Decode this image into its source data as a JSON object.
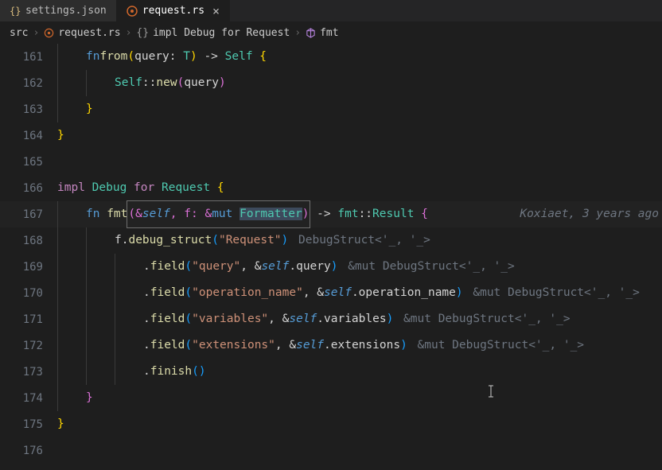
{
  "tabs": [
    {
      "label": "settings.json",
      "icon": "braces",
      "active": false
    },
    {
      "label": "request.rs",
      "icon": "rust",
      "active": true
    }
  ],
  "breadcrumbs": [
    {
      "label": "src",
      "icon": null
    },
    {
      "label": "request.rs",
      "icon": "rust"
    },
    {
      "label": "impl Debug for Request",
      "icon": "braces"
    },
    {
      "label": "fmt",
      "icon": "cube"
    }
  ],
  "code": {
    "161": {
      "kw_fn": "fn",
      "fn": "from",
      "p1": "(",
      "arg": "query",
      "colon": ": ",
      "ty": "T",
      "p2": ")",
      "arrow": " -> ",
      "ty2": "Self",
      "sp": " ",
      "ob": "{"
    },
    "162": {
      "ty": "Self",
      "dd": "::",
      "fn": "new",
      "p1": "(",
      "arg": "query",
      "p2": ")"
    },
    "163": {
      "cb": "}"
    },
    "164": {
      "cb": "}"
    },
    "165": {},
    "166": {
      "impl": "impl",
      "sp": " ",
      "ty1": "Debug",
      "sp2": " ",
      "for": "for",
      "sp3": " ",
      "ty2": "Request",
      "sp4": " ",
      "ob": "{"
    },
    "167": {
      "kw_fn": "fn",
      "sp": " ",
      "fn": "fmt",
      "p1": "(",
      "amp1": "&",
      "self": "self",
      "comma": ", ",
      "argf": "f",
      "colon": ": &",
      "mut": "mut",
      "sp2": " ",
      "ty": "Formatter",
      "p2": ")",
      "arrow": " -> ",
      "ns": "fmt",
      "dd": "::",
      "ty2": "Result",
      "sp3": " ",
      "ob": "{",
      "blame": "Koxiaet, 3 years ago"
    },
    "168": {
      "argf": "f",
      "dot": ".",
      "fn": "debug_struct",
      "p1": "(",
      "s": "\"Request\"",
      "p2": ")",
      "hint": " DebugStruct<'_, '_>"
    },
    "169": {
      "dot": ".",
      "fn": "field",
      "p1": "(",
      "s": "\"query\"",
      "comma": ", &",
      "self": "self",
      "dot2": ".",
      "m": "query",
      "p2": ")",
      "hint": " &mut DebugStruct<'_, '_>"
    },
    "170": {
      "dot": ".",
      "fn": "field",
      "p1": "(",
      "s": "\"operation_name\"",
      "comma": ", &",
      "self": "self",
      "dot2": ".",
      "m": "operation_name",
      "p2": ")",
      "hint": " &mut DebugStruct<'_, '_>"
    },
    "171": {
      "dot": ".",
      "fn": "field",
      "p1": "(",
      "s": "\"variables\"",
      "comma": ", &",
      "self": "self",
      "dot2": ".",
      "m": "variables",
      "p2": ")",
      "hint": " &mut DebugStruct<'_, '_>"
    },
    "172": {
      "dot": ".",
      "fn": "field",
      "p1": "(",
      "s": "\"extensions\"",
      "comma": ", &",
      "self": "self",
      "dot2": ".",
      "m": "extensions",
      "p2": ")",
      "hint": " &mut DebugStruct<'_, '_>"
    },
    "173": {
      "dot": ".",
      "fn": "finish",
      "p1": "(",
      "p2": ")"
    },
    "174": {
      "cb": "}"
    },
    "175": {
      "cb": "}"
    },
    "176": {}
  },
  "line_numbers": [
    "161",
    "162",
    "163",
    "164",
    "165",
    "166",
    "167",
    "168",
    "169",
    "170",
    "171",
    "172",
    "173",
    "174",
    "175",
    "176"
  ],
  "colors": {
    "bg": "#1e1e1e",
    "keyword_purple": "#c586c0",
    "keyword_blue": "#569cd6",
    "type": "#4ec9b0",
    "function": "#dcdcaa",
    "string": "#ce9178",
    "hint": "#6e7681"
  }
}
